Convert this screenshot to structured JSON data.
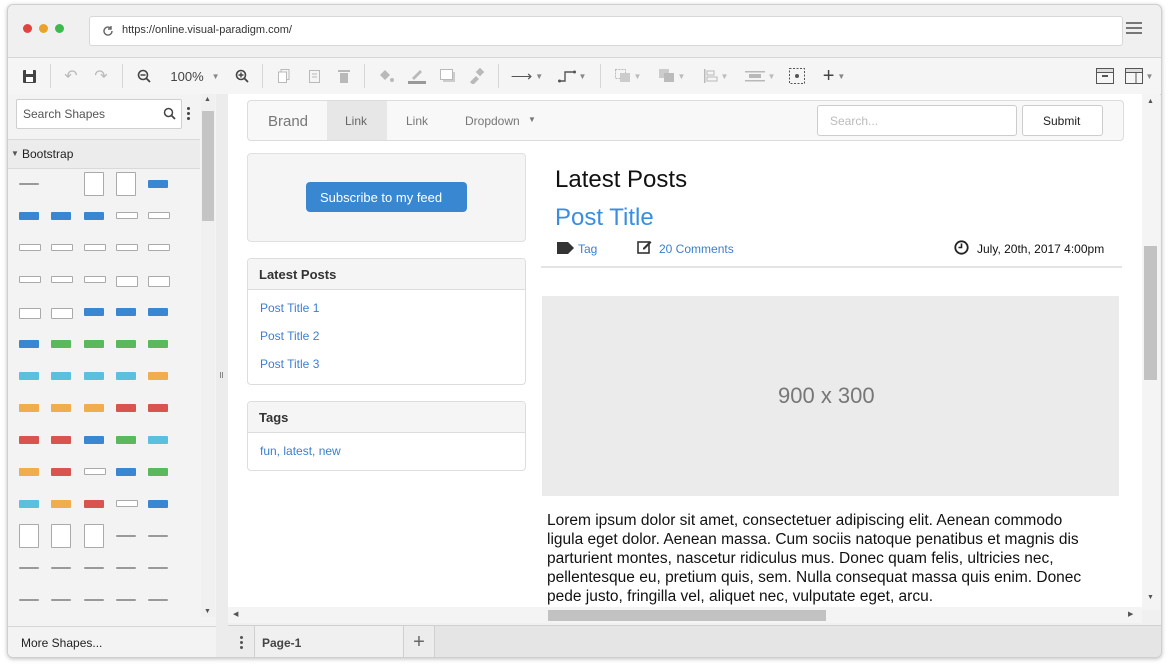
{
  "browser": {
    "url": "https://online.visual-paradigm.com/"
  },
  "toolbar": {
    "zoom": "100%"
  },
  "sidebar": {
    "search_placeholder": "Search Shapes",
    "category": "Bootstrap",
    "more_shapes": "More Shapes...",
    "shape_label": "Button"
  },
  "page_tabs": {
    "current": "Page-1"
  },
  "mockup": {
    "navbar": {
      "brand": "Brand",
      "links": [
        "Link",
        "Link"
      ],
      "dropdown": "Dropdown",
      "search_placeholder": "Search...",
      "submit": "Submit"
    },
    "subscribe_button": "Subscribe to my feed",
    "latest_panel": {
      "title": "Latest Posts",
      "items": [
        "Post Title 1",
        "Post Title 2",
        "Post Title 3"
      ]
    },
    "tags_panel": {
      "title": "Tags",
      "content": "fun, latest, new"
    },
    "main": {
      "heading": "Latest Posts",
      "post_title": "Post Title",
      "tag": "Tag",
      "comments": "20 Comments",
      "date": "July, 20th, 2017 4:00pm",
      "image_placeholder": "900 x 300",
      "body_lines": [
        "Lorem ipsum dolor sit amet, consectetuer adipiscing elit. Aenean commodo",
        "ligula eget dolor. Aenean massa. Cum sociis natoque penatibus et magnis dis",
        "parturient montes, nascetur ridiculus mus. Donec quam felis, ultricies nec,",
        "pellentesque eu, pretium quis, sem. Nulla consequat massa quis enim. Donec",
        "pede justo, fringilla vel, aliquet nec, vulputate eget, arcu."
      ]
    }
  },
  "colors": {
    "primary": "#3a87d1",
    "link": "#3c7fd0",
    "success": "#5cb85c",
    "info": "#5bc0de",
    "warning": "#f0ad4e",
    "danger": "#d9534f"
  }
}
